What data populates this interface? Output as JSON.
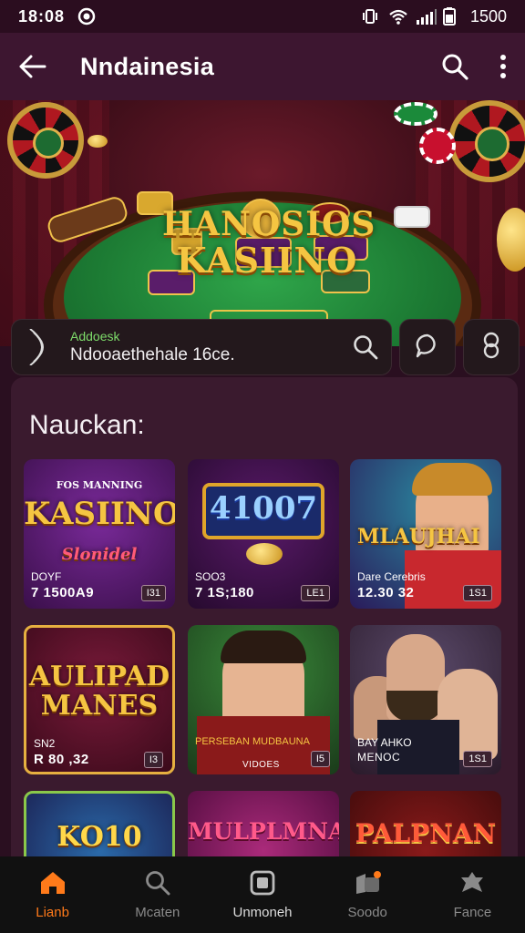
{
  "status_bar": {
    "time": "18:08",
    "right_text": "1500"
  },
  "app_bar": {
    "title": "Nndainesia"
  },
  "hero": {
    "logo_line1": "HANOSIOS",
    "logo_line2": "KASIINO"
  },
  "search": {
    "hint": "Addoesk",
    "value": "Ndooaethehale 16ce."
  },
  "section": {
    "title": "Nauckan:"
  },
  "games": [
    {
      "art_text": "KASIINO",
      "art_sub": "Slonidel",
      "art_top": "FOS MANNING",
      "sub": "DOYF",
      "meta": "7 1500A9",
      "badge": "I31"
    },
    {
      "art_text": "41007",
      "art_sub": "",
      "art_top": "",
      "sub": "SOO3",
      "meta": "7 1S;180",
      "badge": "LE1"
    },
    {
      "art_text": "MLAUJHAI",
      "art_sub": "",
      "art_top": "",
      "sub": "Dare Cerebris",
      "meta": "12.30 32",
      "badge": "1S1"
    },
    {
      "art_text": "AULIPAD MANES",
      "art_sub": "",
      "art_top": "",
      "sub": "SN2",
      "meta": "R 80 ,32",
      "badge": "I3"
    },
    {
      "art_text": "",
      "art_sub": "",
      "art_top": "",
      "sub": "PERSEBAN MUDBAUNA",
      "meta": "VIDOES",
      "badge": "I5"
    },
    {
      "art_text": "",
      "art_sub": "",
      "art_top": "",
      "sub": "BAY AHKO",
      "meta": "MENOC",
      "badge": "1S1"
    },
    {
      "art_text": "KO10",
      "art_sub": "",
      "art_top": "",
      "sub": "",
      "meta": "",
      "badge": ""
    },
    {
      "art_text": "MULPLMNAX",
      "art_sub": "",
      "art_top": "",
      "sub": "",
      "meta": "",
      "badge": ""
    },
    {
      "art_text": "PALPNAN",
      "art_sub": "",
      "art_top": "",
      "sub": "",
      "meta": "",
      "badge": ""
    }
  ],
  "bottom_nav": [
    {
      "label": "Lianb",
      "icon": "home-icon",
      "state": "active"
    },
    {
      "label": "Mcaten",
      "icon": "search-icon",
      "state": ""
    },
    {
      "label": "Unmoneh",
      "icon": "wallet-icon",
      "state": "bold"
    },
    {
      "label": "Soodo",
      "icon": "notification-icon",
      "state": ""
    },
    {
      "label": "Fance",
      "icon": "puzzle-icon",
      "state": ""
    }
  ],
  "colors": {
    "accent": "#ff7a1a",
    "background": "#2a0f20",
    "app_bar": "#3d1630",
    "panel": "#3a1a2e",
    "hint_green": "#7ddc6a"
  }
}
